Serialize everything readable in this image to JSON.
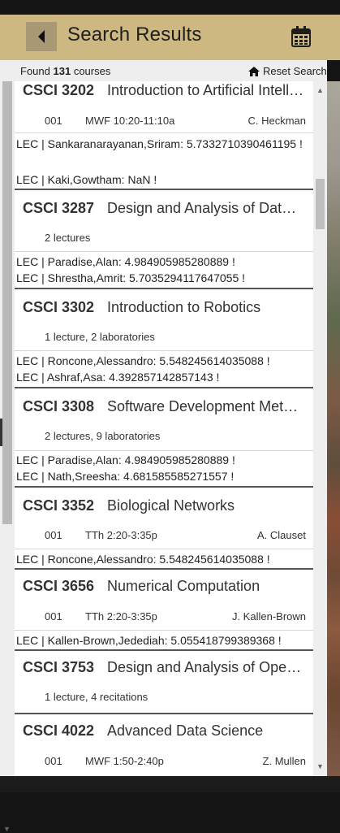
{
  "header": {
    "title": "Search Results"
  },
  "subheader": {
    "found_prefix": "Found",
    "count": "131",
    "found_suffix": "courses",
    "reset_label": "Reset Search"
  },
  "courses": [
    {
      "code": "CSCI 3202",
      "name": "Introduction to Artificial Intelligence",
      "section": "001",
      "days_time": "MWF 10:20-11:10a",
      "instructor": "C. Heckman",
      "ratings": [
        "LEC | Sankaranarayanan,Sriram: 5.7332710390461195 !",
        "LEC | Kaki,Gowtham: NaN !"
      ]
    },
    {
      "code": "CSCI 3287",
      "name": "Design and Analysis of Database Systems",
      "summary": "2 lectures",
      "ratings": [
        "LEC | Paradise,Alan: 4.984905985280889 !",
        "LEC | Shrestha,Amrit: 5.7035294117647055 !"
      ]
    },
    {
      "code": "CSCI 3302",
      "name": "Introduction to Robotics",
      "summary": "1 lecture, 2 laboratories",
      "ratings": [
        "LEC | Roncone,Alessandro: 5.548245614035088 !",
        "LEC | Ashraf,Asa: 4.392857142857143 !"
      ]
    },
    {
      "code": "CSCI 3308",
      "name": "Software Development Methods and Tools",
      "summary": "2 lectures, 9 laboratories",
      "ratings": [
        "LEC | Paradise,Alan: 4.984905985280889 !",
        "LEC | Nath,Sreesha: 4.681585585271557 !"
      ]
    },
    {
      "code": "CSCI 3352",
      "name": "Biological Networks",
      "section": "001",
      "days_time": "TTh 2:20-3:35p",
      "instructor": "A. Clauset",
      "ratings": [
        "LEC | Roncone,Alessandro: 5.548245614035088 !"
      ]
    },
    {
      "code": "CSCI 3656",
      "name": "Numerical Computation",
      "section": "001",
      "days_time": "TTh 2:20-3:35p",
      "instructor": "J. Kallen-Brown",
      "ratings": [
        "LEC | Kallen-Brown,Jedediah: 5.055418799389368 !"
      ]
    },
    {
      "code": "CSCI 3753",
      "name": "Design and Analysis of Operating Systems",
      "summary": "1 lecture, 4 recitations"
    },
    {
      "code": "CSCI 4022",
      "name": "Advanced Data Science",
      "section": "001",
      "days_time": "MWF 1:50-2:40p",
      "instructor": "Z. Mullen"
    }
  ],
  "icons": {
    "back": "back-arrow-icon",
    "calendar": "calendar-icon",
    "home": "home-icon"
  },
  "colors": {
    "header_bg": "#cdb881",
    "back_btn_bg": "#a89873"
  }
}
